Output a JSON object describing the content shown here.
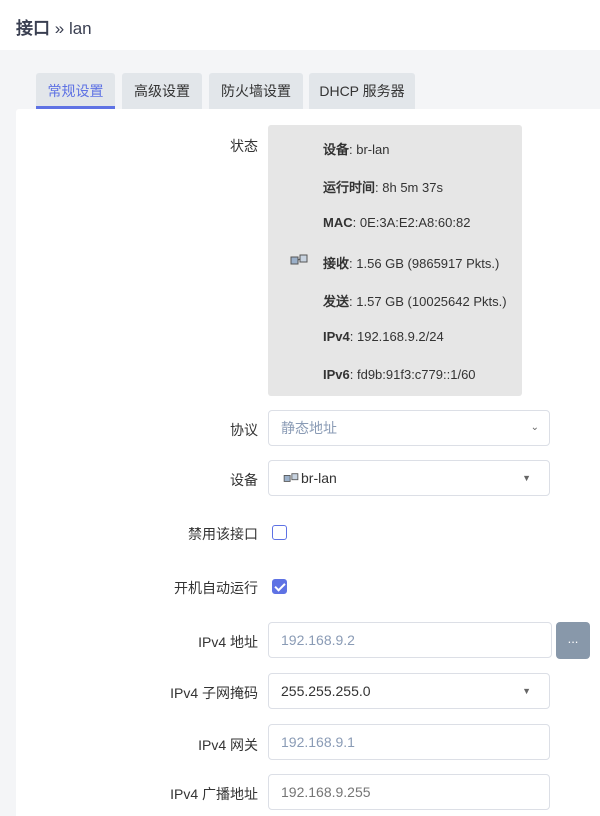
{
  "header": {
    "title": "接口",
    "sep": "»",
    "sub": "lan"
  },
  "tabs": [
    "常规设置",
    "高级设置",
    "防火墙设置",
    "DHCP 服务器"
  ],
  "status": {
    "label": "状态",
    "device": {
      "k": "设备",
      "v": "br-lan"
    },
    "uptime": {
      "k": "运行时间",
      "v": "8h 5m 37s"
    },
    "mac": {
      "k": "MAC",
      "v": "0E:3A:E2:A8:60:82"
    },
    "rx": {
      "k": "接收",
      "v": "1.56 GB (9865917 Pkts.)"
    },
    "tx": {
      "k": "发送",
      "v": "1.57 GB (10025642 Pkts.)"
    },
    "ipv4": {
      "k": "IPv4",
      "v": "192.168.9.2/24"
    },
    "ipv6": {
      "k": "IPv6",
      "v": "fd9b:91f3:c779::1/60"
    }
  },
  "form": {
    "protocol": {
      "label": "协议",
      "value": "静态地址"
    },
    "device": {
      "label": "设备",
      "value": "br-lan"
    },
    "disable": {
      "label": "禁用该接口",
      "checked": false
    },
    "autostart": {
      "label": "开机自动运行",
      "checked": true
    },
    "ipv4addr": {
      "label": "IPv4 地址",
      "value": "192.168.9.2",
      "more": "..."
    },
    "netmask": {
      "label": "IPv4 子网掩码",
      "value": "255.255.255.0"
    },
    "gateway": {
      "label": "IPv4 网关",
      "value": "192.168.9.1"
    },
    "broadcast": {
      "label": "IPv4 广播地址",
      "placeholder": "192.168.9.255"
    }
  },
  "colors": {
    "accent": "#5e72e4",
    "status_bg": "#e6e6e6",
    "tab_bg": "#e2e6ea"
  }
}
